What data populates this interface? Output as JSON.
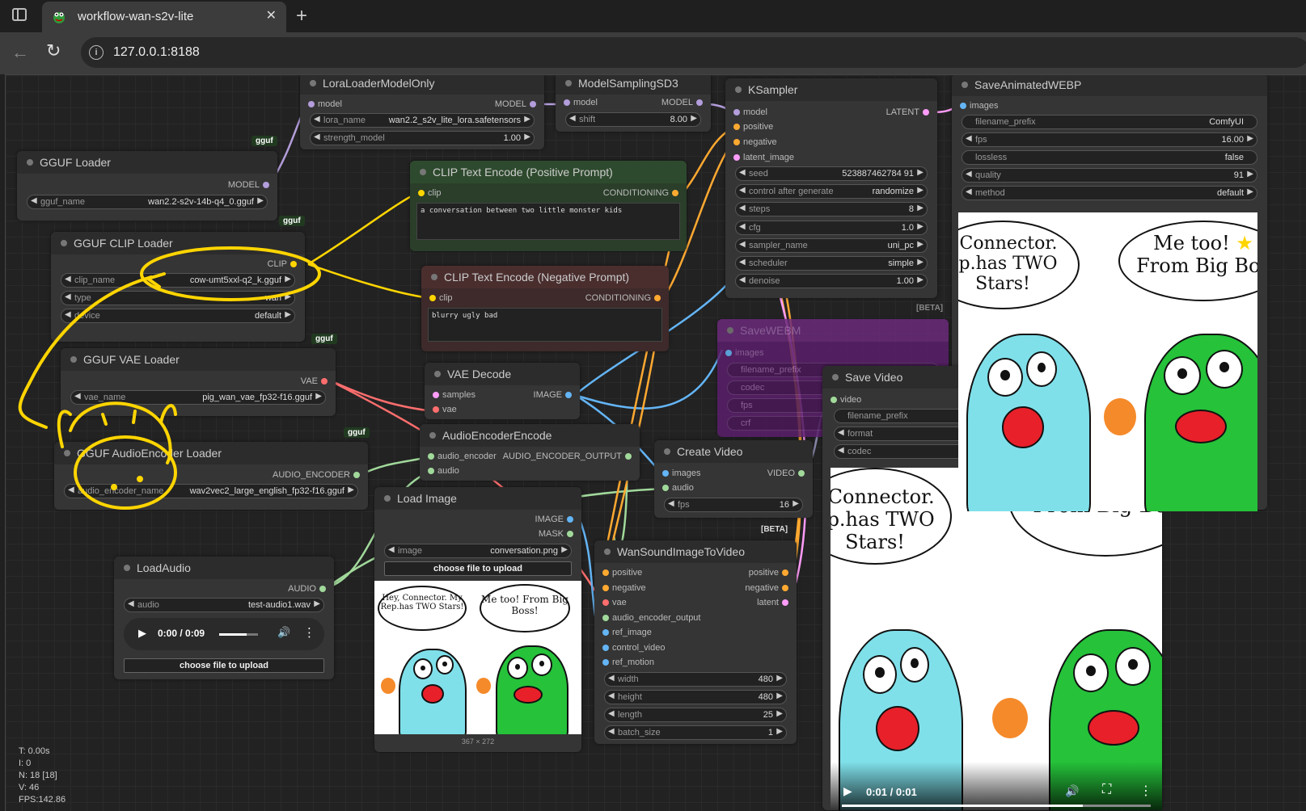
{
  "browser": {
    "tab_title": "workflow-wan-s2v-lite",
    "url": "127.0.0.1:8188"
  },
  "nodes": {
    "lora_loader": {
      "title": "LoraLoaderModelOnly",
      "in_model": "model",
      "out_model": "MODEL",
      "lora_label": "lora_name",
      "lora_value": "wan2.2_s2v_lite_lora.safetensors",
      "strength_label": "strength_model",
      "strength_value": "1.00"
    },
    "model_sampling": {
      "title": "ModelSamplingSD3",
      "in_model": "model",
      "out_model": "MODEL",
      "shift_label": "shift",
      "shift_value": "8.00"
    },
    "ksampler": {
      "title": "KSampler",
      "inputs": [
        "model",
        "positive",
        "negative",
        "latent_image"
      ],
      "out_latent": "LATENT",
      "widgets": [
        {
          "label": "seed",
          "value": "523887462784 91"
        },
        {
          "label": "control after generate",
          "value": "randomize"
        },
        {
          "label": "steps",
          "value": "8"
        },
        {
          "label": "cfg",
          "value": "1.0"
        },
        {
          "label": "sampler_name",
          "value": "uni_pc"
        },
        {
          "label": "scheduler",
          "value": "simple"
        },
        {
          "label": "denoise",
          "value": "1.00"
        }
      ]
    },
    "save_webp": {
      "title": "SaveAnimatedWEBP",
      "in_images": "images",
      "widgets": [
        {
          "label": "filename_prefix",
          "value": "ComfyUI"
        },
        {
          "label": "fps",
          "value": "16.00"
        },
        {
          "label": "lossless",
          "value": "false"
        },
        {
          "label": "quality",
          "value": "91"
        },
        {
          "label": "method",
          "value": "default"
        }
      ]
    },
    "gguf_loader": {
      "title": "GGUF Loader",
      "out_model": "MODEL",
      "name_label": "gguf_name",
      "name_value": "wan2.2-s2v-14b-q4_0.gguf",
      "badge": "gguf"
    },
    "clip_pos": {
      "title": "CLIP Text Encode (Positive Prompt)",
      "in_clip": "clip",
      "out": "CONDITIONING",
      "text": "a conversation between two little monster kids"
    },
    "clip_neg": {
      "title": "CLIP Text Encode (Negative Prompt)",
      "in_clip": "clip",
      "out": "CONDITIONING",
      "text": "blurry ugly bad"
    },
    "gguf_clip": {
      "title": "GGUF CLIP Loader",
      "out_clip": "CLIP",
      "badge": "gguf",
      "widgets": [
        {
          "label": "clip_name",
          "value": "cow-umt5xxl-q2_k.gguf"
        },
        {
          "label": "type",
          "value": "wan"
        },
        {
          "label": "device",
          "value": "default"
        }
      ]
    },
    "gguf_vae": {
      "title": "GGUF VAE Loader",
      "out_vae": "VAE",
      "name_label": "vae_name",
      "name_value": "pig_wan_vae_fp32-f16.gguf",
      "badge": "gguf"
    },
    "vae_decode": {
      "title": "VAE Decode",
      "in_samples": "samples",
      "in_vae": "vae",
      "out_image": "IMAGE"
    },
    "save_webm": {
      "title": "SaveWEBM",
      "beta": "[BETA]",
      "in_images": "images",
      "widgets": [
        "filename_prefix",
        "codec",
        "fps",
        "crf"
      ]
    },
    "save_video": {
      "title": "Save Video",
      "in_video": "video",
      "widgets": [
        "filename_prefix",
        "format",
        "codec"
      ],
      "time": "0:01 / 0:01"
    },
    "audio_encoder_loader": {
      "title": "GGUF AudioEncoder Loader",
      "out": "AUDIO_ENCODER",
      "name_label": "audio_encoder_name",
      "name_value": "wav2vec2_large_english_fp32-f16.gguf",
      "badge": "gguf"
    },
    "audio_encoder_encode": {
      "title": "AudioEncoderEncode",
      "in_encoder": "audio_encoder",
      "in_audio": "audio",
      "out": "AUDIO_ENCODER_OUTPUT"
    },
    "create_video": {
      "title": "Create Video",
      "in_images": "images",
      "in_audio": "audio",
      "out_video": "VIDEO",
      "fps_label": "fps",
      "fps_value": "16"
    },
    "load_image": {
      "title": "Load Image",
      "out_image": "IMAGE",
      "out_mask": "MASK",
      "image_label": "image",
      "image_value": "conversation.png",
      "upload": "choose file to upload",
      "dims": "367 × 272"
    },
    "load_audio": {
      "title": "LoadAudio",
      "out_audio": "AUDIO",
      "audio_label": "audio",
      "audio_value": "test-audio1.wav",
      "time": "0:00 / 0:09",
      "upload": "choose file to upload"
    },
    "wan_s2v": {
      "title": "WanSoundImageToVideo",
      "beta": "[BETA]",
      "inputs": [
        "positive",
        "negative",
        "vae",
        "audio_encoder_output",
        "ref_image",
        "control_video",
        "ref_motion"
      ],
      "outputs": [
        "positive",
        "negative",
        "latent"
      ],
      "widgets": [
        {
          "label": "width",
          "value": "480"
        },
        {
          "label": "height",
          "value": "480"
        },
        {
          "label": "length",
          "value": "25"
        },
        {
          "label": "batch_size",
          "value": "1"
        }
      ]
    }
  },
  "comic": {
    "left_bubble": "Hey, Connector. My Rep.has TWO Stars!",
    "right_bubble": "Me too! From Big Boss!"
  },
  "stats": {
    "t": "T: 0.00s",
    "i": "I: 0",
    "n": "N: 18 [18]",
    "v": "V: 46",
    "fps": "FPS:142.86"
  },
  "colors": {
    "clip": "#ffd500",
    "conditioning": "#ffa931",
    "model": "#b39ddb",
    "vae": "#ff6e6e",
    "image": "#64b5f6",
    "latent": "#ff9cf9",
    "audio": "#a1d99b"
  }
}
